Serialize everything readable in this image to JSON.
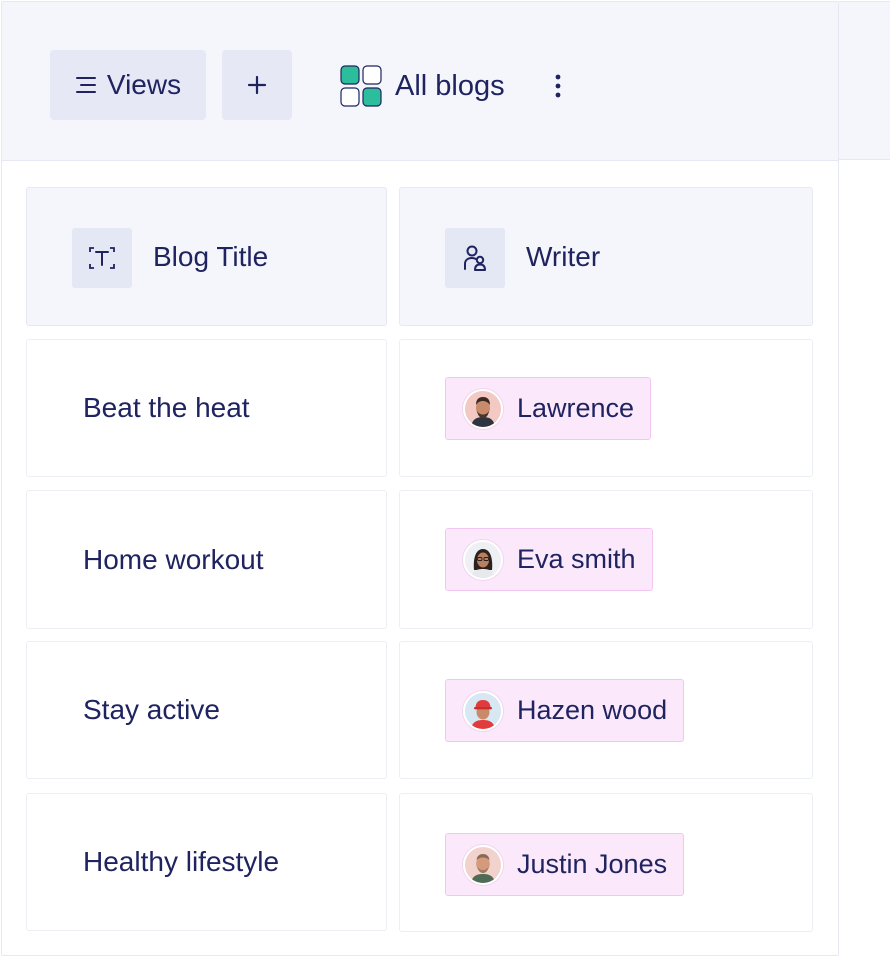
{
  "toolbar": {
    "views_label": "Views",
    "add_label": "+",
    "view_name": "All blogs"
  },
  "columns": {
    "title_header": "Blog Title",
    "writer_header": "Writer"
  },
  "rows": [
    {
      "title": "Beat the heat",
      "writer": "Lawrence"
    },
    {
      "title": "Home workout",
      "writer": "Eva smith"
    },
    {
      "title": "Stay active",
      "writer": "Hazen wood"
    },
    {
      "title": "Healthy lifestyle",
      "writer": "Justin Jones"
    }
  ],
  "colors": {
    "accent_green": "#2bbd9c",
    "chip_bg": "#fbe9fb",
    "chip_border": "#f3c6f2",
    "text": "#1f2360",
    "toolbar_bg": "#f4f6fc"
  },
  "icons": {
    "views": "menu-lines-icon",
    "add": "plus-icon",
    "app": "grid-app-icon",
    "more": "kebab-icon",
    "text_field": "text-field-icon",
    "user_field": "users-icon"
  }
}
